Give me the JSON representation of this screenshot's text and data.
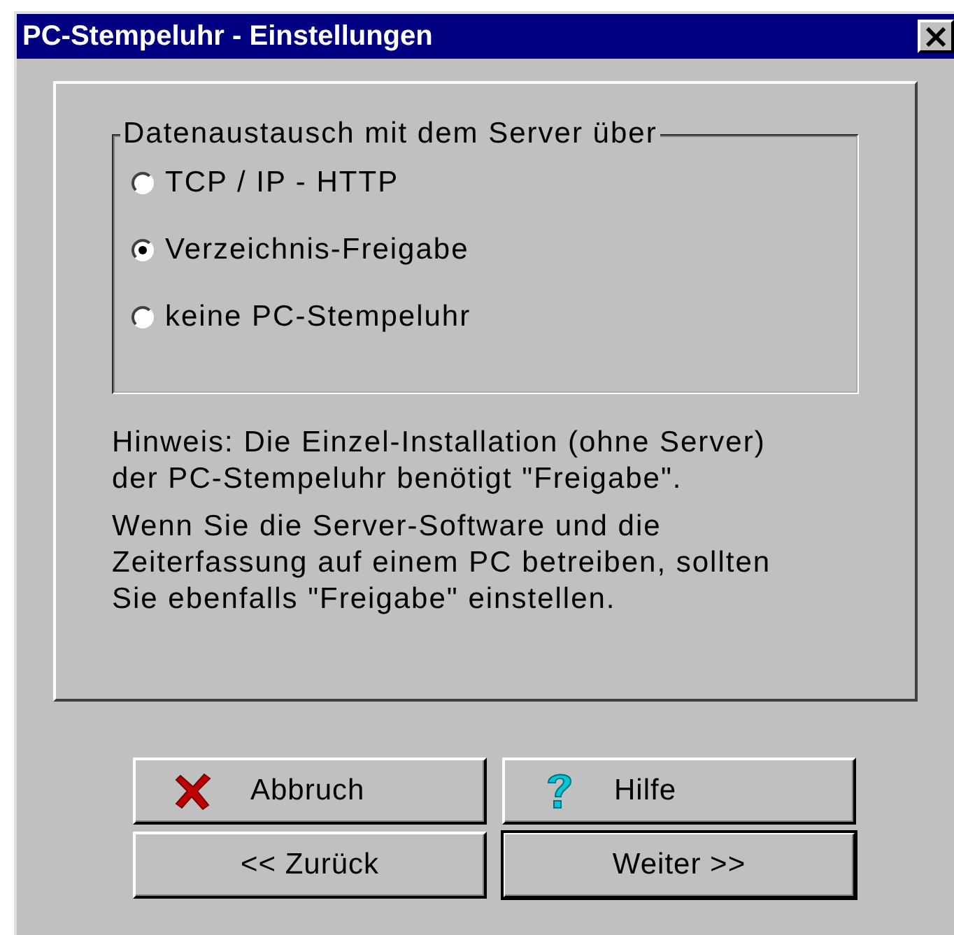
{
  "window": {
    "title": "PC-Stempeluhr - Einstellungen",
    "close": "×"
  },
  "group": {
    "title": "Datenaustausch mit dem Server über",
    "options": [
      {
        "label": "TCP / IP - HTTP",
        "selected": false
      },
      {
        "label": "Verzeichnis-Freigabe",
        "selected": true
      },
      {
        "label": "keine PC-Stempeluhr",
        "selected": false
      }
    ]
  },
  "notes": [
    "Hinweis: Die Einzel-Installation (ohne Server) der PC-Stempeluhr benötigt \"Freigabe\".",
    "Wenn Sie die Server-Software und die Zeiterfassung auf einem PC betreiben, sollten Sie ebenfalls \"Freigabe\" einstellen."
  ],
  "buttons": [
    {
      "label": "Abbruch",
      "kind": "cancel",
      "default": false
    },
    {
      "label": "Hilfe",
      "kind": "help",
      "default": false
    },
    {
      "label": "<< Zurück",
      "kind": "plain",
      "default": false
    },
    {
      "label": "Weiter >>",
      "kind": "plain",
      "default": true
    }
  ]
}
